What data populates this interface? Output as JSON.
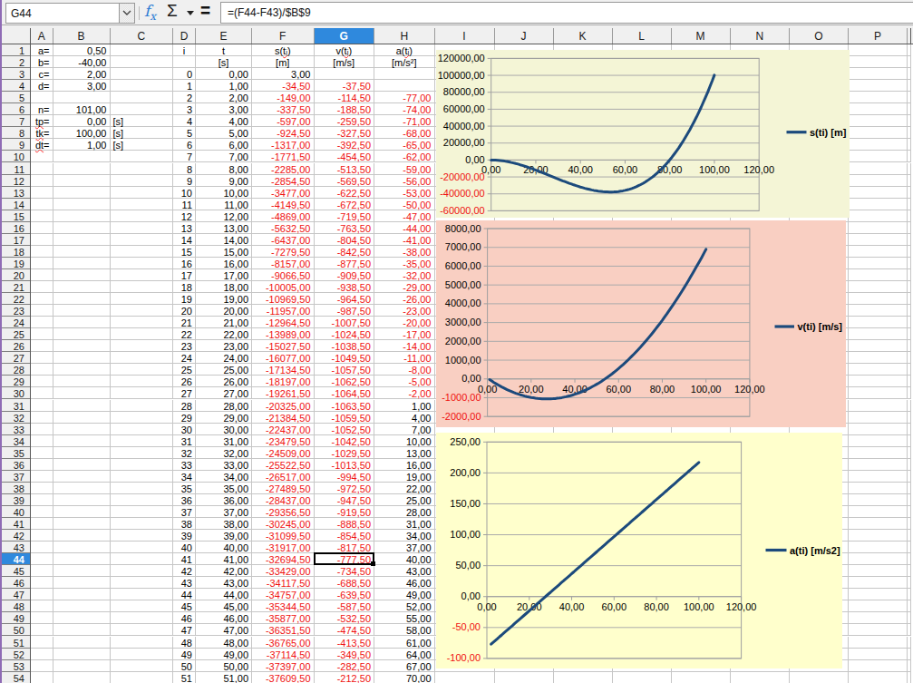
{
  "formula_bar": {
    "name_box": "G44",
    "formula": "=(F44-F43)/$B$9",
    "fx_label": "fx",
    "sum_label": "Σ",
    "equals_label": "="
  },
  "colors": {
    "header_highlight": "#2f89dd",
    "negative_red": "#ef1010",
    "series_blue": "#1c4a7c",
    "chart1_bg": "#f4f5d6",
    "chart2_bg": "#f9cfc2",
    "chart3_bg": "#ffffcc",
    "window_edge": "#8f6bb5"
  },
  "sheet": {
    "columns": [
      "A",
      "B",
      "C",
      "D",
      "E",
      "F",
      "G",
      "H",
      "I",
      "J",
      "K",
      "L",
      "M",
      "N",
      "O",
      "P"
    ],
    "selected_column": "G",
    "selected_row": 44,
    "spellcheck_cells": [
      "A7",
      "A8",
      "A9",
      "F1",
      "G1",
      "H1"
    ],
    "rows": [
      {
        "n": 1,
        "c": {
          "A": "a=",
          "B": "0,50",
          "D": "i",
          "E": "t",
          "F": "s(tᵢ)",
          "G": "v(tᵢ)",
          "H": "a(tᵢ)"
        }
      },
      {
        "n": 2,
        "c": {
          "A": "b=",
          "B": "-40,00",
          "E": "[s]",
          "F": "[m]",
          "G": "[m/s]",
          "H": "[m/s²]"
        }
      },
      {
        "n": 3,
        "c": {
          "A": "c=",
          "B": "2,00",
          "D": "0",
          "E": "0,00",
          "F": "3,00"
        }
      },
      {
        "n": 4,
        "c": {
          "A": "d=",
          "B": "3,00",
          "D": "1",
          "E": "1,00",
          "F": "-34,50",
          "G": "-37,50"
        }
      },
      {
        "n": 5,
        "c": {
          "D": "2",
          "E": "2,00",
          "F": "-149,00",
          "G": "-114,50",
          "H": "-77,00"
        }
      },
      {
        "n": 6,
        "c": {
          "A": "n=",
          "B": "101,00",
          "D": "3",
          "E": "3,00",
          "F": "-337,50",
          "G": "-188,50",
          "H": "-74,00"
        }
      },
      {
        "n": 7,
        "c": {
          "A": "tp=",
          "B": "0,00",
          "C": "[s]",
          "D": "4",
          "E": "4,00",
          "F": "-597,00",
          "G": "-259,50",
          "H": "-71,00"
        }
      },
      {
        "n": 8,
        "c": {
          "A": "tk=",
          "B": "100,00",
          "C": "[s]",
          "D": "5",
          "E": "5,00",
          "F": "-924,50",
          "G": "-327,50",
          "H": "-68,00"
        }
      },
      {
        "n": 9,
        "c": {
          "A": "dt=",
          "B": "1,00",
          "C": "[s]",
          "D": "6",
          "E": "6,00",
          "F": "-1317,00",
          "G": "-392,50",
          "H": "-65,00"
        }
      },
      {
        "n": 10,
        "c": {
          "D": "7",
          "E": "7,00",
          "F": "-1771,50",
          "G": "-454,50",
          "H": "-62,00"
        }
      },
      {
        "n": 11,
        "c": {
          "D": "8",
          "E": "8,00",
          "F": "-2285,00",
          "G": "-513,50",
          "H": "-59,00"
        }
      },
      {
        "n": 12,
        "c": {
          "D": "9",
          "E": "9,00",
          "F": "-2854,50",
          "G": "-569,50",
          "H": "-56,00"
        }
      },
      {
        "n": 13,
        "c": {
          "D": "10",
          "E": "10,00",
          "F": "-3477,00",
          "G": "-622,50",
          "H": "-53,00"
        }
      },
      {
        "n": 14,
        "c": {
          "D": "11",
          "E": "11,00",
          "F": "-4149,50",
          "G": "-672,50",
          "H": "-50,00"
        }
      },
      {
        "n": 15,
        "c": {
          "D": "12",
          "E": "12,00",
          "F": "-4869,00",
          "G": "-719,50",
          "H": "-47,00"
        }
      },
      {
        "n": 16,
        "c": {
          "D": "13",
          "E": "13,00",
          "F": "-5632,50",
          "G": "-763,50",
          "H": "-44,00"
        }
      },
      {
        "n": 17,
        "c": {
          "D": "14",
          "E": "14,00",
          "F": "-6437,00",
          "G": "-804,50",
          "H": "-41,00"
        }
      },
      {
        "n": 18,
        "c": {
          "D": "15",
          "E": "15,00",
          "F": "-7279,50",
          "G": "-842,50",
          "H": "-38,00"
        }
      },
      {
        "n": 19,
        "c": {
          "D": "16",
          "E": "16,00",
          "F": "-8157,00",
          "G": "-877,50",
          "H": "-35,00"
        }
      },
      {
        "n": 20,
        "c": {
          "D": "17",
          "E": "17,00",
          "F": "-9066,50",
          "G": "-909,50",
          "H": "-32,00"
        }
      },
      {
        "n": 21,
        "c": {
          "D": "18",
          "E": "18,00",
          "F": "-10005,00",
          "G": "-938,50",
          "H": "-29,00"
        }
      },
      {
        "n": 22,
        "c": {
          "D": "19",
          "E": "19,00",
          "F": "-10969,50",
          "G": "-964,50",
          "H": "-26,00"
        }
      },
      {
        "n": 23,
        "c": {
          "D": "20",
          "E": "20,00",
          "F": "-11957,00",
          "G": "-987,50",
          "H": "-23,00"
        }
      },
      {
        "n": 24,
        "c": {
          "D": "21",
          "E": "21,00",
          "F": "-12964,50",
          "G": "-1007,50",
          "H": "-20,00"
        }
      },
      {
        "n": 25,
        "c": {
          "D": "22",
          "E": "22,00",
          "F": "-13989,00",
          "G": "-1024,50",
          "H": "-17,00"
        }
      },
      {
        "n": 26,
        "c": {
          "D": "23",
          "E": "23,00",
          "F": "-15027,50",
          "G": "-1038,50",
          "H": "-14,00"
        }
      },
      {
        "n": 27,
        "c": {
          "D": "24",
          "E": "24,00",
          "F": "-16077,00",
          "G": "-1049,50",
          "H": "-11,00"
        }
      },
      {
        "n": 28,
        "c": {
          "D": "25",
          "E": "25,00",
          "F": "-17134,50",
          "G": "-1057,50",
          "H": "-8,00"
        }
      },
      {
        "n": 29,
        "c": {
          "D": "26",
          "E": "26,00",
          "F": "-18197,00",
          "G": "-1062,50",
          "H": "-5,00"
        }
      },
      {
        "n": 30,
        "c": {
          "D": "27",
          "E": "27,00",
          "F": "-19261,50",
          "G": "-1064,50",
          "H": "-2,00"
        }
      },
      {
        "n": 31,
        "c": {
          "D": "28",
          "E": "28,00",
          "F": "-20325,00",
          "G": "-1063,50",
          "H": "1,00"
        }
      },
      {
        "n": 32,
        "c": {
          "D": "29",
          "E": "29,00",
          "F": "-21384,50",
          "G": "-1059,50",
          "H": "4,00"
        }
      },
      {
        "n": 33,
        "c": {
          "D": "30",
          "E": "30,00",
          "F": "-22437,00",
          "G": "-1052,50",
          "H": "7,00"
        }
      },
      {
        "n": 34,
        "c": {
          "D": "31",
          "E": "31,00",
          "F": "-23479,50",
          "G": "-1042,50",
          "H": "10,00"
        }
      },
      {
        "n": 35,
        "c": {
          "D": "32",
          "E": "32,00",
          "F": "-24509,00",
          "G": "-1029,50",
          "H": "13,00"
        }
      },
      {
        "n": 36,
        "c": {
          "D": "33",
          "E": "33,00",
          "F": "-25522,50",
          "G": "-1013,50",
          "H": "16,00"
        }
      },
      {
        "n": 37,
        "c": {
          "D": "34",
          "E": "34,00",
          "F": "-26517,00",
          "G": "-994,50",
          "H": "19,00"
        }
      },
      {
        "n": 38,
        "c": {
          "D": "35",
          "E": "35,00",
          "F": "-27489,50",
          "G": "-972,50",
          "H": "22,00"
        }
      },
      {
        "n": 39,
        "c": {
          "D": "36",
          "E": "36,00",
          "F": "-28437,00",
          "G": "-947,50",
          "H": "25,00"
        }
      },
      {
        "n": 40,
        "c": {
          "D": "37",
          "E": "37,00",
          "F": "-29356,50",
          "G": "-919,50",
          "H": "28,00"
        }
      },
      {
        "n": 41,
        "c": {
          "D": "38",
          "E": "38,00",
          "F": "-30245,00",
          "G": "-888,50",
          "H": "31,00"
        }
      },
      {
        "n": 42,
        "c": {
          "D": "39",
          "E": "39,00",
          "F": "-31099,50",
          "G": "-854,50",
          "H": "34,00"
        }
      },
      {
        "n": 43,
        "c": {
          "D": "40",
          "E": "40,00",
          "F": "-31917,00",
          "G": "-817,50",
          "H": "37,00"
        }
      },
      {
        "n": 44,
        "c": {
          "D": "41",
          "E": "41,00",
          "F": "-32694,50",
          "G": "-777,50",
          "H": "40,00"
        }
      },
      {
        "n": 45,
        "c": {
          "D": "42",
          "E": "42,00",
          "F": "-33429,00",
          "G": "-734,50",
          "H": "43,00"
        }
      },
      {
        "n": 46,
        "c": {
          "D": "43",
          "E": "43,00",
          "F": "-34117,50",
          "G": "-688,50",
          "H": "46,00"
        }
      },
      {
        "n": 47,
        "c": {
          "D": "44",
          "E": "44,00",
          "F": "-34757,00",
          "G": "-639,50",
          "H": "49,00"
        }
      },
      {
        "n": 48,
        "c": {
          "D": "45",
          "E": "45,00",
          "F": "-35344,50",
          "G": "-587,50",
          "H": "52,00"
        }
      },
      {
        "n": 49,
        "c": {
          "D": "46",
          "E": "46,00",
          "F": "-35877,00",
          "G": "-532,50",
          "H": "55,00"
        }
      },
      {
        "n": 50,
        "c": {
          "D": "47",
          "E": "47,00",
          "F": "-36351,50",
          "G": "-474,50",
          "H": "58,00"
        }
      },
      {
        "n": 51,
        "c": {
          "D": "48",
          "E": "48,00",
          "F": "-36765,00",
          "G": "-413,50",
          "H": "61,00"
        }
      },
      {
        "n": 52,
        "c": {
          "D": "49",
          "E": "49,00",
          "F": "-37114,50",
          "G": "-349,50",
          "H": "64,00"
        }
      },
      {
        "n": 53,
        "c": {
          "D": "50",
          "E": "50,00",
          "F": "-37397,00",
          "G": "-282,50",
          "H": "67,00"
        }
      },
      {
        "n": 54,
        "c": {
          "D": "51",
          "E": "51,00",
          "F": "-37609,50",
          "G": "-212,50",
          "H": "70,00"
        }
      }
    ]
  },
  "chart_data": [
    {
      "type": "line",
      "legend": "s(ti) [m]",
      "x_ticks": [
        0,
        20,
        40,
        60,
        80,
        100,
        120
      ],
      "y_ticks": [
        120000,
        100000,
        80000,
        60000,
        40000,
        20000,
        0,
        -20000,
        -40000,
        -60000
      ],
      "y_max": 120000,
      "y_min": -60000,
      "x_max": 120,
      "series": {
        "name": "s(ti) [m]",
        "x_start": 0,
        "x_step": 1,
        "values": [
          3.0,
          -34.5,
          -149.0,
          -337.5,
          -597.0,
          -924.5,
          -1317.0,
          -1771.5,
          -2285.0,
          -2854.5,
          -3477.0,
          -4149.5,
          -4869.0,
          -5632.5,
          -6437.0,
          -7279.5,
          -8157.0,
          -9066.5,
          -10005.0,
          -10969.5,
          -11957.0,
          -12964.5,
          -13989.0,
          -15027.5,
          -16077.0,
          -17134.5,
          -18197.0,
          -19261.5,
          -20325.0,
          -21384.5,
          -22437.0,
          -23479.5,
          -24509.0,
          -25522.5,
          -26517.0,
          -27489.5,
          -28437.0,
          -29356.5,
          -30245.0,
          -31099.5,
          -31917.0,
          -32694.5,
          -33429.0,
          -34117.5,
          -34757.0,
          -35344.5,
          -35877.0,
          -36351.5,
          -36765.0,
          -37114.5,
          -37397.0,
          -37609.5,
          -37749.0,
          -37812.5,
          -37797.0,
          -37699.5,
          -37517.0,
          -37246.5,
          -36885.0,
          -36429.5,
          -35877.0,
          -35224.5,
          -34469.0,
          -33607.5,
          -32637.0,
          -31554.5,
          -30357.0,
          -29041.5,
          -27605.0,
          -26044.5,
          -24357.0,
          -22539.5,
          -20589.0,
          -18502.5,
          -16277.0,
          -13909.5,
          -11397.0,
          -8736.5,
          -5925.0,
          -2959.5,
          163.0,
          3445.5,
          6891.0,
          10502.5,
          14283.0,
          18235.5,
          22363.0,
          26668.5,
          31155.0,
          35825.5,
          40683.0,
          45730.5,
          50971.0,
          56407.5,
          62043.0,
          67880.5,
          73923.0,
          80173.5,
          86635.0,
          93310.5,
          100203.0
        ]
      }
    },
    {
      "type": "line",
      "legend": "v(ti) [m/s]",
      "x_ticks": [
        0,
        20,
        40,
        60,
        80,
        100,
        120
      ],
      "y_ticks": [
        8000,
        7000,
        6000,
        5000,
        4000,
        3000,
        2000,
        1000,
        0,
        -1000,
        -2000
      ],
      "y_max": 8000,
      "y_min": -2000,
      "x_max": 120,
      "series": {
        "name": "v(ti) [m/s]",
        "x_start": 1,
        "x_step": 1,
        "values": [
          -37.5,
          -114.5,
          -188.5,
          -259.5,
          -327.5,
          -392.5,
          -454.5,
          -513.5,
          -569.5,
          -622.5,
          -672.5,
          -719.5,
          -763.5,
          -804.5,
          -842.5,
          -877.5,
          -909.5,
          -938.5,
          -964.5,
          -987.5,
          -1007.5,
          -1024.5,
          -1038.5,
          -1049.5,
          -1057.5,
          -1062.5,
          -1064.5,
          -1063.5,
          -1059.5,
          -1052.5,
          -1042.5,
          -1029.5,
          -1013.5,
          -994.5,
          -972.5,
          -947.5,
          -919.5,
          -888.5,
          -854.5,
          -817.5,
          -777.5,
          -734.5,
          -688.5,
          -639.5,
          -587.5,
          -532.5,
          -474.5,
          -413.5,
          -349.5,
          -282.5,
          -212.5,
          -139.5,
          -63.5,
          15.5,
          97.5,
          182.5,
          270.5,
          361.5,
          455.5,
          552.5,
          652.5,
          755.5,
          861.5,
          970.5,
          1082.5,
          1197.5,
          1315.5,
          1436.5,
          1560.5,
          1687.5,
          1817.5,
          1950.5,
          2086.5,
          2225.5,
          2367.5,
          2512.5,
          2660.5,
          2811.5,
          2965.5,
          3122.5,
          3282.5,
          3445.5,
          3611.5,
          3780.5,
          3952.5,
          4127.5,
          4305.5,
          4486.5,
          4670.5,
          4857.5,
          5047.5,
          5240.5,
          5436.5,
          5635.5,
          5837.5,
          6042.5,
          6250.5,
          6461.5,
          6675.5,
          6892.5
        ]
      }
    },
    {
      "type": "line",
      "legend": "a(ti) [m/s2]",
      "x_ticks": [
        0,
        20,
        40,
        60,
        80,
        100,
        120
      ],
      "y_ticks": [
        250,
        200,
        150,
        100,
        50,
        0,
        -50,
        -100
      ],
      "y_max": 250,
      "y_min": -100,
      "x_max": 120,
      "series": {
        "name": "a(ti) [m/s2]",
        "x_start": 2,
        "x_step": 1,
        "values": [
          -77.0,
          -74.0,
          -71.0,
          -68.0,
          -65.0,
          -62.0,
          -59.0,
          -56.0,
          -53.0,
          -50.0,
          -47.0,
          -44.0,
          -41.0,
          -38.0,
          -35.0,
          -32.0,
          -29.0,
          -26.0,
          -23.0,
          -20.0,
          -17.0,
          -14.0,
          -11.0,
          -8.0,
          -5.0,
          -2.0,
          1.0,
          4.0,
          7.0,
          10.0,
          13.0,
          16.0,
          19.0,
          22.0,
          25.0,
          28.0,
          31.0,
          34.0,
          37.0,
          40.0,
          43.0,
          46.0,
          49.0,
          52.0,
          55.0,
          58.0,
          61.0,
          64.0,
          67.0,
          70.0,
          73.0,
          76.0,
          79.0,
          82.0,
          85.0,
          88.0,
          91.0,
          94.0,
          97.0,
          100.0,
          103.0,
          106.0,
          109.0,
          112.0,
          115.0,
          118.0,
          121.0,
          124.0,
          127.0,
          130.0,
          133.0,
          136.0,
          139.0,
          142.0,
          145.0,
          148.0,
          151.0,
          154.0,
          157.0,
          160.0,
          163.0,
          166.0,
          169.0,
          172.0,
          175.0,
          178.0,
          181.0,
          184.0,
          187.0,
          190.0,
          193.0,
          196.0,
          199.0,
          202.0,
          205.0,
          208.0,
          211.0,
          214.0,
          217.0
        ]
      }
    }
  ]
}
